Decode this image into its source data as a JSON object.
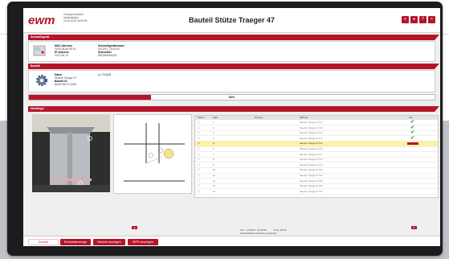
{
  "app": {
    "title": "Bauteil Stütze Traeger 47",
    "user_lines": [
      "Christoph Brehler",
      "Administrator",
      "22.08.2019 16:09:05"
    ]
  },
  "header_buttons": [
    "menu-icon",
    "user-icon",
    "help-icon",
    "exit-icon"
  ],
  "sections": {
    "machine": "Schweißgerät",
    "part": "Bauteil",
    "weld_seams": "Nahtfolge"
  },
  "machine": {
    "mac_label": "MAC-Adresse",
    "mac_value": "00:00:4E:50:0E:01",
    "ip_label": "IP-Adresse",
    "ip_value": "10.0.204.76",
    "id_label": "Schweißgerätename",
    "id_value": "6.8.2017, 15:03:33",
    "type_label": "Schweißer",
    "type_value": "WE000099K003"
  },
  "part": {
    "name_label": "Name",
    "name_value": "Stuetze Traeger 47",
    "id_label": "Bauteil ID",
    "id_value": "BAUR-85-2712049",
    "id_extra": "7243828"
  },
  "progress": {
    "percent": 30,
    "label": "30%"
  },
  "table": {
    "columns": [
      "Status",
      "Naht",
      "Prozess",
      "WPS-Nr",
      "Info"
    ],
    "rows": [
      {
        "nr": "1",
        "wps": "Stuetze Traeger 47 A.1",
        "done": true
      },
      {
        "nr": "2",
        "wps": "Stuetze Traeger 47 A.2",
        "done": true
      },
      {
        "nr": "3",
        "wps": "Stuetze Traeger 47 A.3",
        "done": true
      },
      {
        "nr": "4",
        "wps": "Stuetze Traeger 47 A.4",
        "done": true
      },
      {
        "nr": "5",
        "wps": "Stuetze Traeger 47 A.5",
        "done": false,
        "active": true
      },
      {
        "nr": "6",
        "wps": "Stuetze Traeger 47 A.6",
        "done": false
      },
      {
        "nr": "7",
        "wps": "Stuetze Traeger 47 A.7",
        "done": false
      },
      {
        "nr": "8",
        "wps": "Stuetze Traeger 47 A.8",
        "done": false
      },
      {
        "nr": "9",
        "wps": "Stuetze Traeger 47 A.9",
        "done": false
      },
      {
        "nr": "10",
        "wps": "Stuetze Traeger 47 B.1",
        "done": false
      },
      {
        "nr": "11",
        "wps": "Stuetze Traeger 47 B.2",
        "done": false
      },
      {
        "nr": "12",
        "wps": "Stuetze Traeger 47 B.3",
        "done": false
      },
      {
        "nr": "13",
        "wps": "Stuetze Traeger 47 B.4",
        "done": false
      },
      {
        "nr": "14",
        "wps": "Stuetze Traeger 47 B.5",
        "done": false
      }
    ]
  },
  "status_info": {
    "label": "Info",
    "timestamp": "6.8.2017, 15:03:08",
    "message": "Nahtverifikationsfunktion geändert",
    "timer": "Time: 00:24"
  },
  "bottom": {
    "back": "Zurück",
    "btn1": "Echtzeitanzeige",
    "btn2": "Bauteil anzeigen",
    "btn3": "WPS anzeigen"
  },
  "colors": {
    "accent": "#b5152b",
    "highlight": "#fbf2a8",
    "check": "#3c9b2f"
  }
}
